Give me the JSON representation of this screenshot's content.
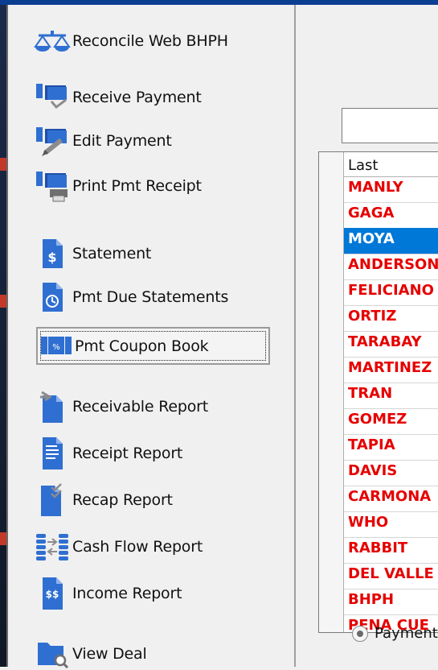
{
  "menu": {
    "items": [
      {
        "label": "Reconcile Web BHPH",
        "icon": "scales-icon"
      },
      {
        "label": "Receive Payment",
        "icon": "receive-payment-icon"
      },
      {
        "label": "Edit Payment",
        "icon": "edit-payment-icon"
      },
      {
        "label": "Print Pmt Receipt",
        "icon": "print-receipt-icon"
      },
      {
        "label": "Statement",
        "icon": "statement-icon"
      },
      {
        "label": "Pmt Due Statements",
        "icon": "due-statements-icon"
      },
      {
        "label": "Pmt Coupon Book",
        "icon": "coupon-book-icon"
      },
      {
        "label": "Receivable Report",
        "icon": "receivable-report-icon"
      },
      {
        "label": "Receipt Report",
        "icon": "receipt-report-icon"
      },
      {
        "label": "Recap Report",
        "icon": "recap-report-icon"
      },
      {
        "label": "Cash Flow Report",
        "icon": "cash-flow-icon"
      },
      {
        "label": "Income Report",
        "icon": "income-report-icon"
      },
      {
        "label": "View Deal",
        "icon": "view-deal-icon"
      }
    ]
  },
  "grid": {
    "header": "Last",
    "rows": [
      "MANLY",
      "GAGA",
      "MOYA",
      "ANDERSON",
      "FELICIANO",
      "ORTIZ",
      "TARABAY",
      "MARTINEZ",
      "TRAN",
      "GOMEZ",
      "TAPIA",
      "DAVIS",
      "CARMONA",
      "WHO",
      "RABBIT",
      "DEL VALLE",
      "BHPH",
      "PENA CUE"
    ],
    "selected": "MOYA"
  },
  "options": {
    "payment_label": "Payment"
  },
  "colors": {
    "name_text": "#e60000",
    "selection": "#0078d7",
    "icon_blue": "#2f6fd1"
  }
}
